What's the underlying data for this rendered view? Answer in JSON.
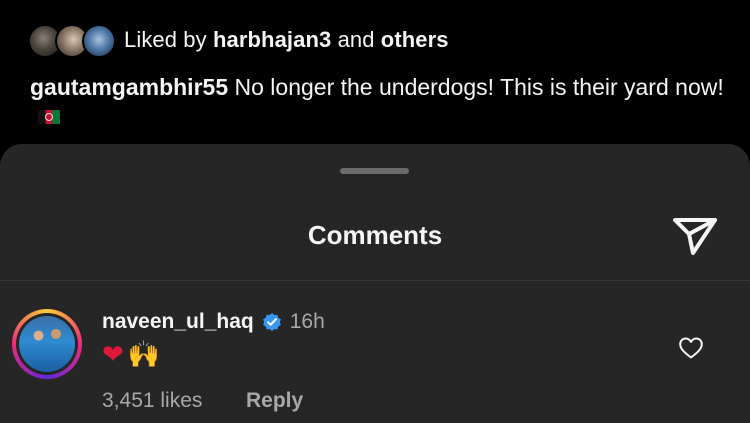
{
  "post": {
    "liked_by_prefix": "Liked by",
    "liked_by_user": "harbhajan3",
    "liked_by_and": "and",
    "liked_by_others": "others",
    "caption_user": "gautamgambhir55",
    "caption_text": "No longer the underdogs! This is their yard now!",
    "caption_flag": "afghanistan-flag-icon"
  },
  "sheet": {
    "title": "Comments",
    "share_icon": "send-icon"
  },
  "comments": [
    {
      "username": "naveen_ul_haq",
      "verified": true,
      "time": "16h",
      "body_emoji_1": "❤",
      "body_emoji_2": "🙌",
      "likes": "3,451 likes",
      "reply_label": "Reply",
      "like_icon": "heart-outline-icon"
    }
  ],
  "colors": {
    "background": "#000000",
    "sheet": "#262626",
    "muted_text": "#a8a8a8",
    "verified_blue": "#3897f0",
    "heart_red": "#e0183a"
  }
}
